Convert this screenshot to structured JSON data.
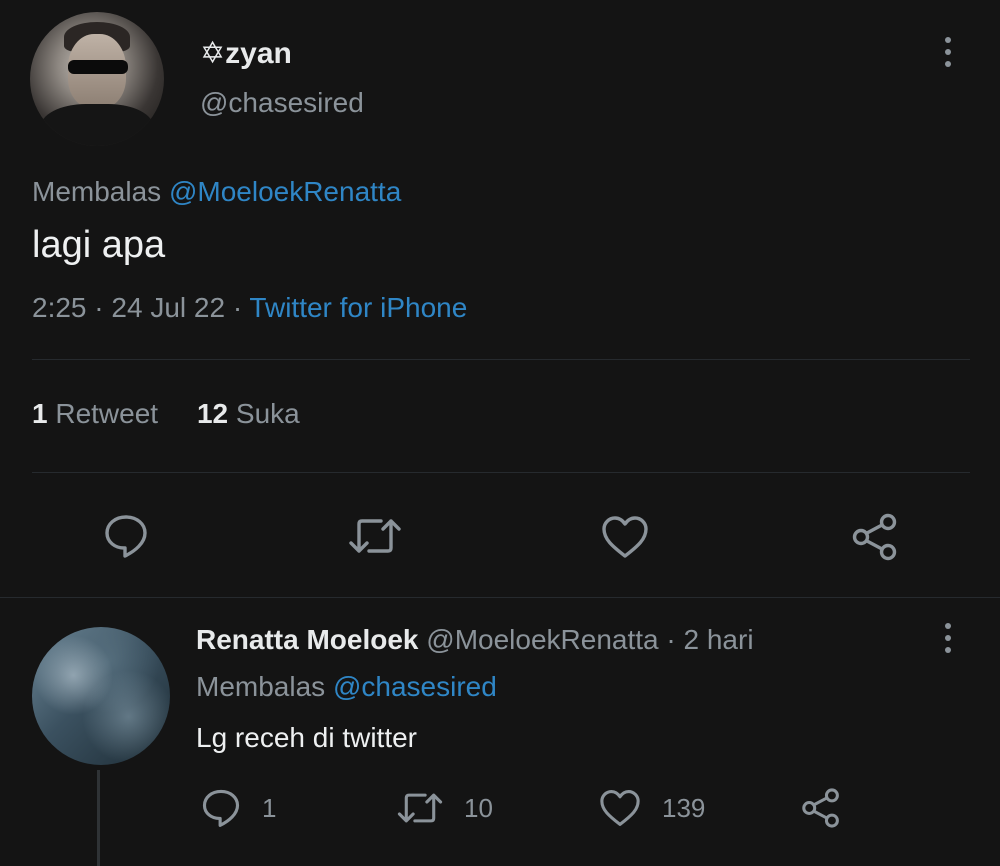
{
  "tweet": {
    "display_name": "✡zyan",
    "handle": "@chasesired",
    "reply_prefix": "Membalas",
    "reply_to": "@MoeloekRenatta",
    "text": "lagi apa",
    "time": "2:25",
    "date": "24 Jul 22",
    "source": "Twitter for iPhone",
    "sep": "·",
    "retweet_count": "1",
    "retweet_label": "Retweet",
    "like_count": "12",
    "like_label": "Suka"
  },
  "reply": {
    "display_name": "Renatta Moeloek",
    "handle": "@MoeloekRenatta",
    "sep": "·",
    "age": "2 hari",
    "reply_prefix": "Membalas",
    "reply_to": "@chasesired",
    "text": "Lg receh di twitter",
    "reply_count": "1",
    "retweet_count": "10",
    "like_count": "139"
  },
  "colors": {
    "background": "#141414",
    "link": "#2f86c6",
    "muted": "#8b939a",
    "text": "#eef0f1"
  },
  "icons": [
    "more-vertical-icon",
    "reply-icon",
    "retweet-icon",
    "like-icon",
    "share-icon"
  ]
}
